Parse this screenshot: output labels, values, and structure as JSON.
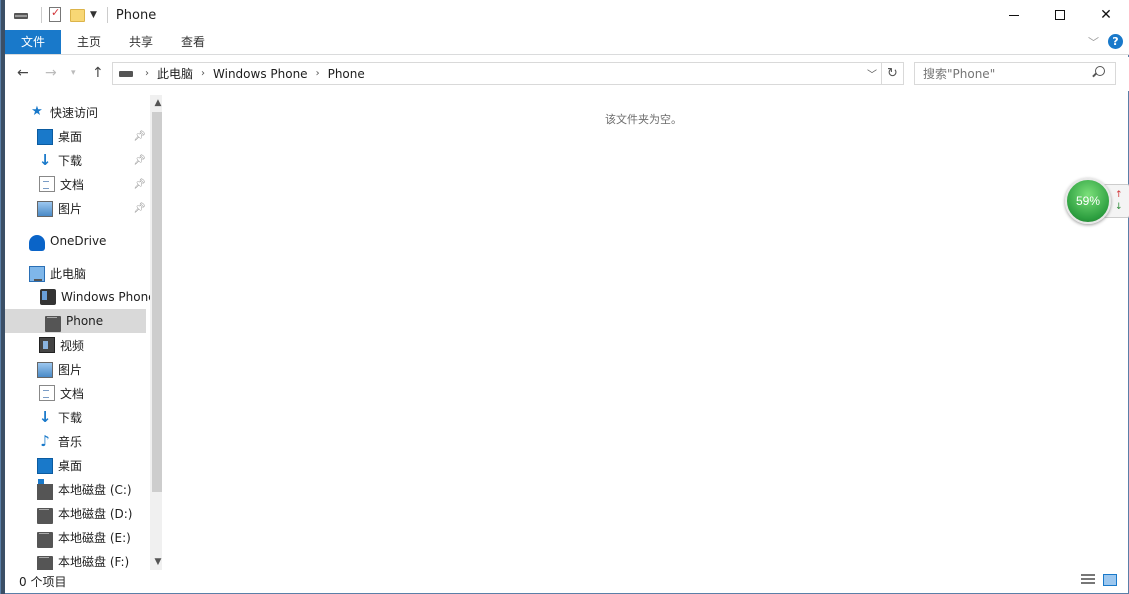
{
  "window": {
    "title": "Phone"
  },
  "ribbon": {
    "tabs": [
      {
        "label": "文件"
      },
      {
        "label": "主页"
      },
      {
        "label": "共享"
      },
      {
        "label": "查看"
      }
    ]
  },
  "address": {
    "crumbs": [
      "此电脑",
      "Windows Phone",
      "Phone"
    ]
  },
  "search": {
    "placeholder": "搜索\"Phone\""
  },
  "nav": {
    "items": [
      {
        "label": "快速访问",
        "icon": "star-icon"
      },
      {
        "label": "桌面",
        "icon": "desktop-icon",
        "pinned": true
      },
      {
        "label": "下载",
        "icon": "download-icon",
        "pinned": true
      },
      {
        "label": "文档",
        "icon": "document-icon",
        "pinned": true
      },
      {
        "label": "图片",
        "icon": "picture-icon",
        "pinned": true
      },
      {
        "label": "OneDrive",
        "icon": "onedrive-icon"
      },
      {
        "label": "此电脑",
        "icon": "computer-icon"
      },
      {
        "label": "Windows Phone",
        "icon": "phone-icon"
      },
      {
        "label": "Phone",
        "icon": "drive-icon",
        "selected": true
      },
      {
        "label": "视频",
        "icon": "video-icon"
      },
      {
        "label": "图片",
        "icon": "picture-icon"
      },
      {
        "label": "文档",
        "icon": "document-icon"
      },
      {
        "label": "下载",
        "icon": "download-icon"
      },
      {
        "label": "音乐",
        "icon": "music-icon"
      },
      {
        "label": "桌面",
        "icon": "desktop-icon"
      },
      {
        "label": "本地磁盘 (C:)",
        "icon": "system-drive-icon"
      },
      {
        "label": "本地磁盘 (D:)",
        "icon": "drive-icon"
      },
      {
        "label": "本地磁盘 (E:)",
        "icon": "drive-icon"
      },
      {
        "label": "本地磁盘 (F:)",
        "icon": "drive-icon"
      }
    ]
  },
  "content": {
    "empty_message": "该文件夹为空。"
  },
  "status": {
    "item_count": "0 个项目"
  },
  "widget": {
    "percent": "59%"
  },
  "colors": {
    "accent": "#1979ca",
    "selected_bg": "#d9d9d9"
  }
}
